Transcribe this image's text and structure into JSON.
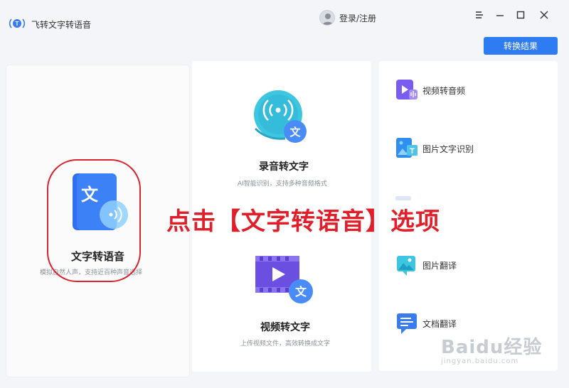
{
  "app": {
    "title": "飞转文字转语音"
  },
  "header": {
    "login_label": "登录/注册"
  },
  "toolbar": {
    "convert_result_label": "转换结果"
  },
  "features": {
    "text_to_speech": {
      "title": "文字转语音",
      "subtitle": "模拟自然人声，支持近百种声音选择"
    },
    "recording_to_text": {
      "title": "录音转文字",
      "subtitle": "AI智能识别，支持多种音频格式"
    },
    "video_to_text": {
      "title": "视频转文字",
      "subtitle": "上传视频文件，高效转换成文字"
    }
  },
  "side_tools": [
    {
      "label": "视频转音频",
      "icon": "video-audio-icon"
    },
    {
      "label": "图片文字识别",
      "icon": "image-ocr-icon"
    },
    {
      "label": "图片翻译",
      "icon": "image-translate-icon"
    },
    {
      "label": "文档翻译",
      "icon": "doc-translate-icon"
    }
  ],
  "annotation": {
    "text": "点击【文字转语音】选项"
  },
  "watermark": {
    "main": "Baidu经验",
    "sub": "jingyan.baidu.com"
  },
  "colors": {
    "accent": "#2f7bf1",
    "annotation_red": "#e01f2a"
  }
}
